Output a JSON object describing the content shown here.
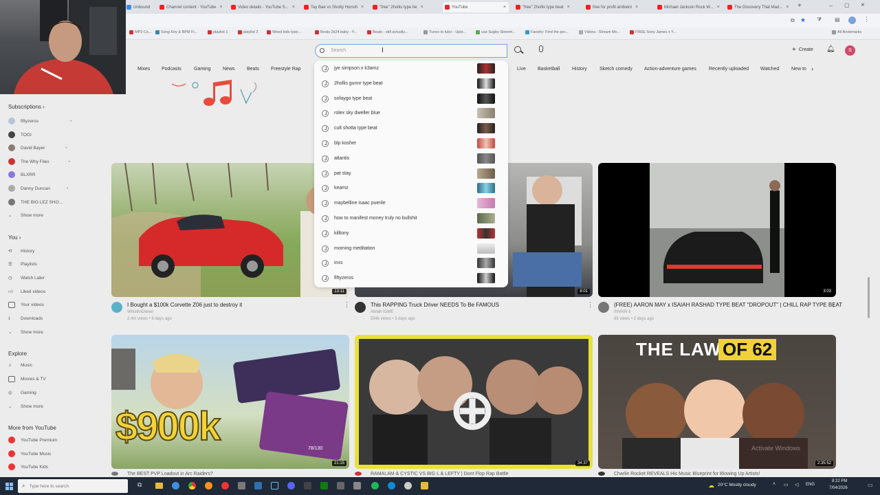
{
  "browser": {
    "tabs": [
      {
        "title": "Unbound",
        "color": "#4285f4"
      },
      {
        "title": "Channel content - YouTube",
        "color": "#e22"
      },
      {
        "title": "Video details - YouTube S...",
        "color": "#e22"
      },
      {
        "title": "Tay Bae vs Shotty Horroh",
        "color": "#e22"
      },
      {
        "title": "\"free\" 2hollis type be",
        "color": "#e22"
      },
      {
        "title": "YouTube",
        "color": "#e22"
      },
      {
        "title": "\"free\" 2hollis type beat",
        "color": "#e22"
      },
      {
        "title": "free for profit ambient",
        "color": "#e22"
      },
      {
        "title": "Michael Jackson Rock W...",
        "color": "#e22"
      },
      {
        "title": "The Discovery That Mad...",
        "color": "#e22"
      }
    ],
    "bookmarks": [
      "MP3 Co...",
      "Song Key & BPM Fi...",
      "playlist 1",
      "playlist 2",
      "Weed kids type...",
      "Beats 2k24 baby - Y...",
      "Beats - still actually...",
      "Tunes to tube - Uplo...",
      "use Sugby Streem...",
      "Fanshy: Find the per...",
      "Vidora - Stream Mo...",
      "FREE Sony James x Y..."
    ],
    "all_bookmarks": "All Bookmarks"
  },
  "youtube": {
    "search": {
      "placeholder": "Search",
      "create_label": "Create",
      "avatar_letter": "S"
    },
    "chips": [
      "Mixes",
      "Podcasts",
      "Gaming",
      "News",
      "Beats",
      "Freestyle Rap",
      "Live",
      "Basketball",
      "History",
      "Sketch comedy",
      "Action-adventure games",
      "Recently uploaded",
      "Watched",
      "New to"
    ],
    "suggestions": [
      "jye simpson x k3amz",
      "2hollis gunnr type beat",
      "sofaygo type beat",
      "rolex sky dweller blue",
      "cult shotta type beat",
      "blp kosher",
      "atlantis",
      "pat stay",
      "keamz",
      "maybelline isaac puerile",
      "how to manifest money truly no bullshit",
      "killtony",
      "morning meditation",
      "inxs",
      "fiftyzeros"
    ],
    "sidebar": {
      "subscriptions_label": "Subscriptions",
      "subscriptions": [
        "fiftyzeros",
        "TOGI",
        "David Bayer",
        "The Why Files",
        "BLXRR",
        "Danny Duncan",
        "THE BIG LEZ SHO..."
      ],
      "show_more": "Show more",
      "you_label": "You",
      "you_items": [
        "History",
        "Playlists",
        "Watch Later",
        "Liked videos",
        "Your videos",
        "Downloads"
      ],
      "explore_label": "Explore",
      "explore_items": [
        "Music",
        "Movies & TV",
        "Gaming"
      ],
      "more_label": "More from YouTube",
      "more_items": [
        "YouTube Premium",
        "YouTube Music",
        "YouTube Kids"
      ]
    },
    "videos": [
      {
        "title": "I Bought a $100k Corvette Z06 just to destroy it",
        "channel": "WhistlinDiesel",
        "meta": "2.4m views • 6 days ago",
        "duration": "13:11"
      },
      {
        "title": "This RAPPING Truck Driver NEEDS To Be FAMOUS",
        "channel": "Akilah IGME",
        "meta": "554k views • 3 days ago",
        "duration": "8:01"
      },
      {
        "title": "(FREE) AARON MAY x ISAIAH RASHAD TYPE BEAT \"DROPOUT\" | CHILL RAP TYPE BEAT",
        "channel": "INVAIN II",
        "meta": "85 views • 2 days ago",
        "duration": "3:03"
      },
      {
        "title": "The BEST PVP Loadout in Arc Raiders?",
        "duration": "21:15",
        "overlay": "$900k",
        "badge": "78/130"
      },
      {
        "title": "RAMALAM & CYSTIC VS BIG L & LEFTY | Dont Flop Rap Battle",
        "duration": "34:37"
      },
      {
        "title": "Charlie Rocket REVEALS His Music Blueprint for Blowing Up Artists!",
        "duration": "2:35:52",
        "overlay_a": "THE LAW",
        "overlay_b": "OF 62"
      }
    ]
  },
  "taskbar": {
    "search_placeholder": "Type here to search",
    "weather": "20°C  Mostly cloudy",
    "lang": "ENG",
    "time": "8:22 PM",
    "date": "7/04/2026"
  },
  "watermark": "Activate Windows"
}
